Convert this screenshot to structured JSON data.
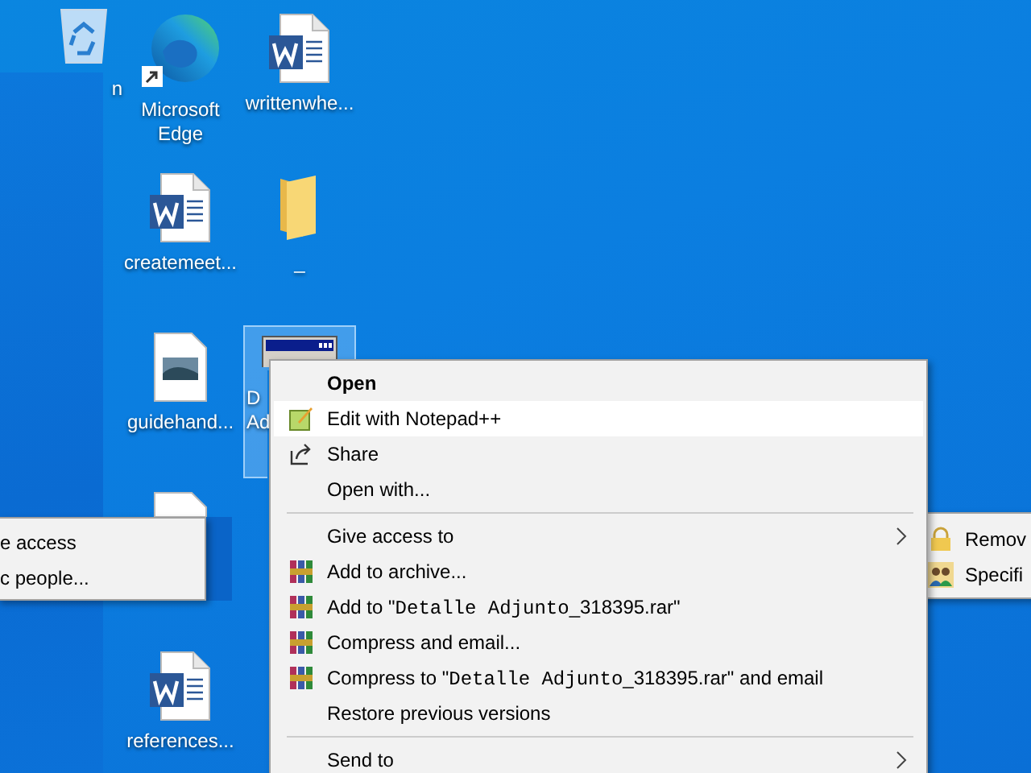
{
  "desktop_columns": [
    [
      {
        "kind": "recycle",
        "label": "n",
        "selected": false
      }
    ],
    [
      {
        "kind": "edge",
        "label": "Microsoft Edge",
        "selected": false
      },
      {
        "kind": "word",
        "label": "createmeet...",
        "selected": false
      },
      {
        "kind": "image",
        "label": "guidehand...",
        "selected": false
      },
      {
        "kind": "blank",
        "selected": false
      },
      {
        "kind": "word",
        "label": "references...",
        "selected": false
      }
    ],
    [
      {
        "kind": "word",
        "label": "writtenwhe...",
        "selected": false
      },
      {
        "kind": "folder",
        "label": "_",
        "selected": false
      },
      {
        "kind": "exe",
        "label": "D Ad",
        "selected": true
      }
    ]
  ],
  "left_submenu": {
    "items": [
      "e access",
      "c people..."
    ]
  },
  "right_submenu": {
    "items": [
      {
        "kind": "lock",
        "label": "Remov"
      },
      {
        "kind": "people",
        "label": "Specifi"
      }
    ]
  },
  "context_menu": {
    "sections": [
      [
        {
          "kind": "default",
          "parts": [
            {
              "text": "Open"
            }
          ],
          "selected": false
        },
        {
          "kind": "notepad",
          "parts": [
            {
              "text": "Edit with Notepad++"
            }
          ],
          "selected": true
        },
        {
          "kind": "share",
          "parts": [
            {
              "text": "Share"
            }
          ],
          "selected": false
        },
        {
          "kind": "plain",
          "parts": [
            {
              "text": "Open with..."
            }
          ],
          "selected": false
        }
      ],
      [
        {
          "kind": "submenu",
          "parts": [
            {
              "text": "Give access to"
            }
          ],
          "selected": false
        },
        {
          "kind": "winrar",
          "parts": [
            {
              "text": "Add to archive..."
            }
          ],
          "selected": false
        },
        {
          "kind": "winrar",
          "parts": [
            {
              "text": "Add to \""
            },
            {
              "text": "Detalle Adjunto",
              "mono": true
            },
            {
              "text": "_318395.rar\""
            }
          ],
          "selected": false
        },
        {
          "kind": "winrar",
          "parts": [
            {
              "text": "Compress and email..."
            }
          ],
          "selected": false
        },
        {
          "kind": "winrar",
          "parts": [
            {
              "text": "Compress to \""
            },
            {
              "text": "Detalle Adjunto",
              "mono": true
            },
            {
              "text": "_318395.rar\" and email"
            }
          ],
          "selected": false
        },
        {
          "kind": "plain",
          "parts": [
            {
              "text": "Restore previous versions"
            }
          ],
          "selected": false
        }
      ],
      [
        {
          "kind": "submenu",
          "parts": [
            {
              "text": "Send to"
            }
          ],
          "selected": false
        }
      ]
    ]
  }
}
